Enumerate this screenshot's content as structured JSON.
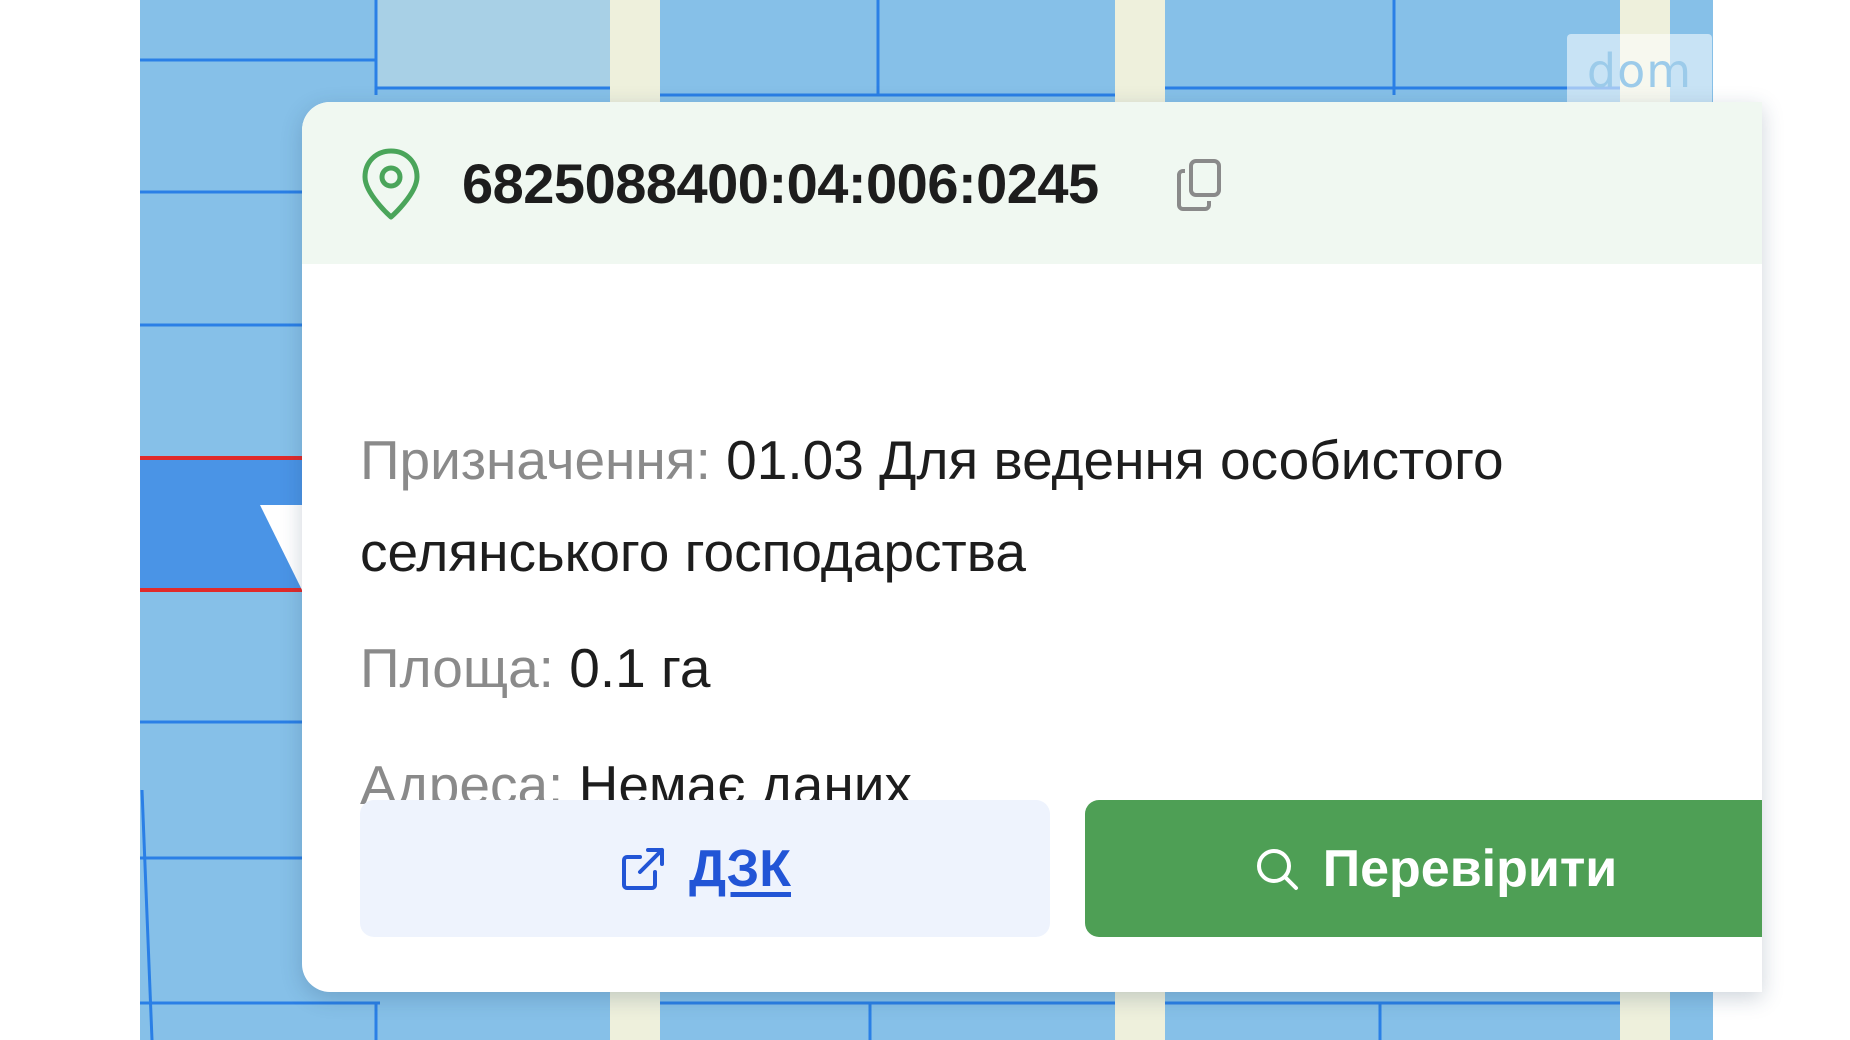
{
  "watermark": {
    "text": "dom"
  },
  "parcel": {
    "cadastral_number": "6825088400:04:006:0245",
    "purpose_label": "Призначення:",
    "purpose_value": "01.03 Для ведення особистого селянського господарства",
    "area_label": "Площа:",
    "area_value": "0.1 га",
    "address_label": "Адреса:",
    "address_value": "Немає даних"
  },
  "actions": {
    "dzk_label": "ДЗК",
    "check_label": "Перевірити"
  },
  "icons": {
    "pin": "location-pin-icon",
    "copy": "copy-icon",
    "external": "external-link-icon",
    "search": "search-icon"
  },
  "colors": {
    "map_fill": "#86c0e8",
    "map_lines": "#2a7fe6",
    "road": "#eef0dc",
    "highlight_border": "#e02a2a",
    "accent_green": "#4e9f55",
    "link_blue": "#2255d6"
  }
}
